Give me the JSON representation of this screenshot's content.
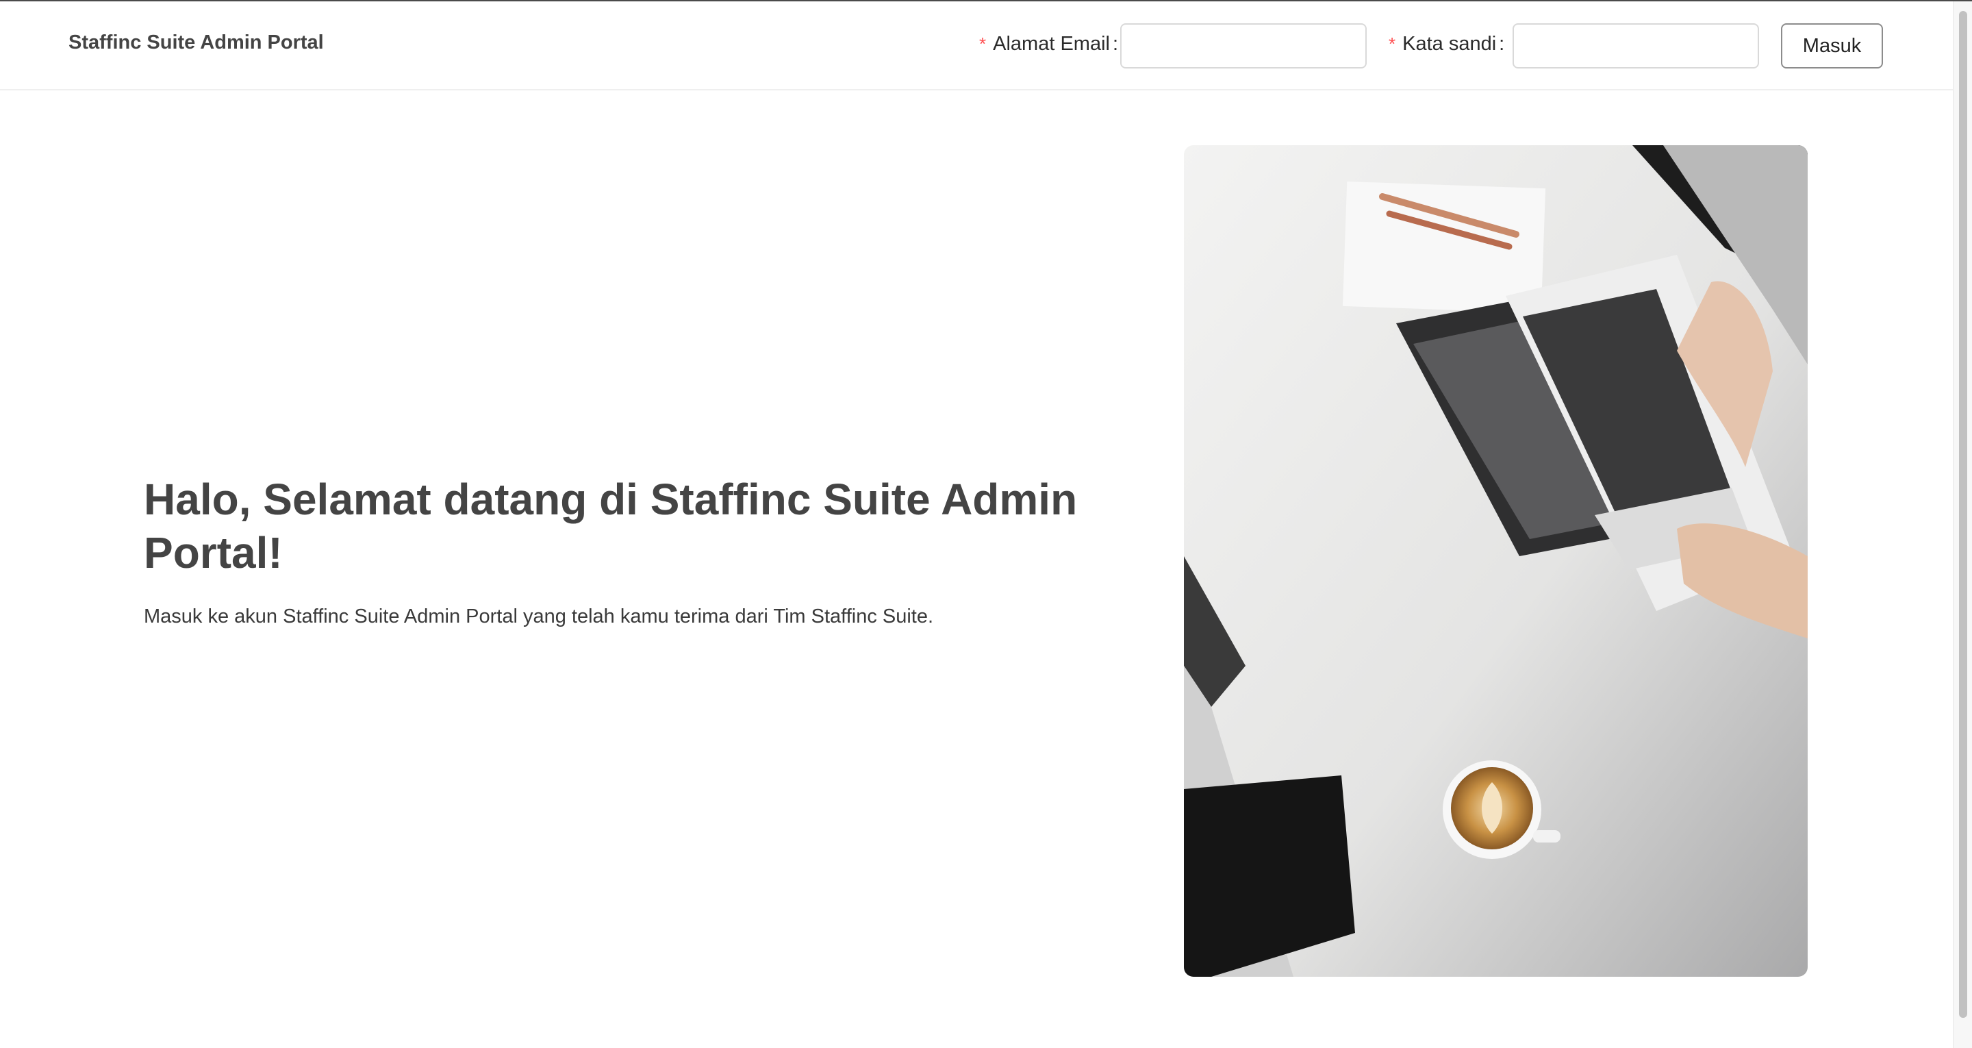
{
  "header": {
    "brand": "Staffinc Suite Admin Portal",
    "email_label": "Alamat Email",
    "password_label": "Kata sandi",
    "required_mark": "*",
    "colon": ":",
    "email_value": "",
    "password_value": "",
    "login_label": "Masuk"
  },
  "hero": {
    "title": "Halo, Selamat datang di Staffinc Suite Admin Portal!",
    "subtitle": "Masuk ke akun Staffinc Suite Admin Portal yang telah kamu terima dari Tim Staffinc Suite."
  },
  "colors": {
    "required": "#ff4d4f",
    "title": "#444444",
    "border": "#d9d9d9"
  },
  "icons": {
    "photo": "laptop-desk-photo"
  }
}
